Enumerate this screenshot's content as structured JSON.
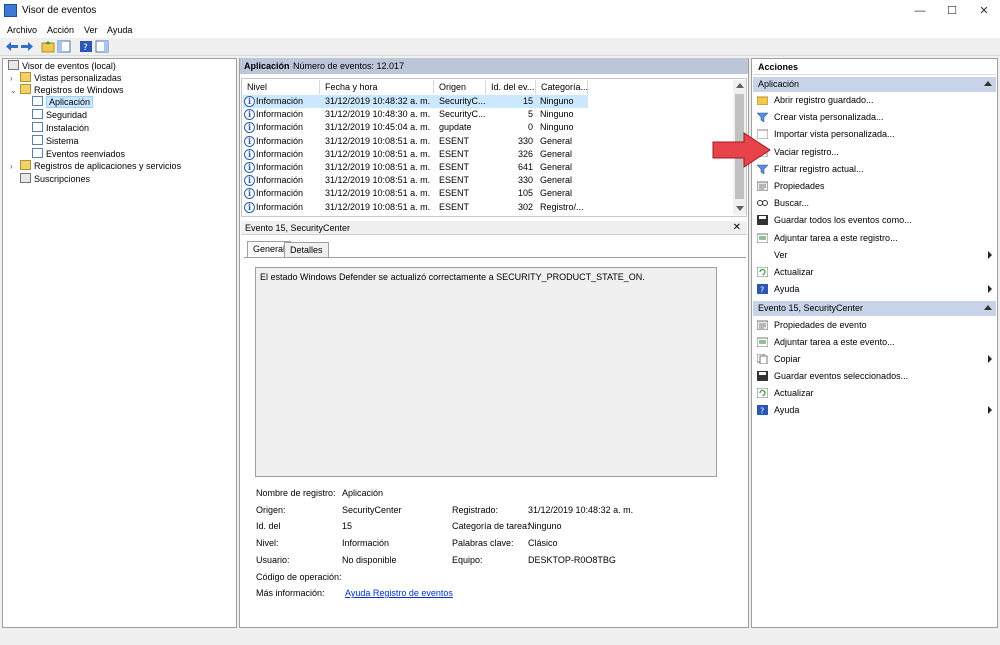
{
  "window": {
    "title": "Visor de eventos",
    "minimize": "—",
    "maximize": "☐",
    "close": "✕"
  },
  "menu": [
    "Archivo",
    "Acción",
    "Ver",
    "Ayuda"
  ],
  "tree": [
    {
      "label": "Visor de eventos (local)",
      "icon": "computer-icon"
    },
    {
      "label": "Vistas personalizadas",
      "icon": "folder-icon",
      "expander": "›"
    },
    {
      "label": "Registros de Windows",
      "icon": "folder-icon",
      "expander": "⌄"
    },
    {
      "label": "Aplicación",
      "icon": "log-icon"
    },
    {
      "label": "Seguridad",
      "icon": "log-icon"
    },
    {
      "label": "Instalación",
      "icon": "log-icon"
    },
    {
      "label": "Sistema",
      "icon": "log-icon"
    },
    {
      "label": "Eventos reenviados",
      "icon": "log-icon"
    },
    {
      "label": "Registros de aplicaciones y servicios",
      "icon": "folder-icon",
      "expander": "›"
    },
    {
      "label": "Suscripciones",
      "icon": "subscription-icon"
    }
  ],
  "center": {
    "log_name": "Aplicación",
    "event_count": "Número de eventos: 12.017",
    "columns": [
      "Nivel",
      "Fecha y hora",
      "Origen",
      "Id. del ev...",
      "Categoría..."
    ],
    "rows": [
      [
        "Información",
        "31/12/2019 10:48:32 a. m.",
        "SecurityC...",
        "15",
        "Ninguno"
      ],
      [
        "Información",
        "31/12/2019 10:48:30 a. m.",
        "SecurityC...",
        "5",
        "Ninguno"
      ],
      [
        "Información",
        "31/12/2019 10:45:04 a. m.",
        "gupdate",
        "0",
        "Ninguno"
      ],
      [
        "Información",
        "31/12/2019 10:08:51 a. m.",
        "ESENT",
        "330",
        "General"
      ],
      [
        "Información",
        "31/12/2019 10:08:51 a. m.",
        "ESENT",
        "326",
        "General"
      ],
      [
        "Información",
        "31/12/2019 10:08:51 a. m.",
        "ESENT",
        "641",
        "General"
      ],
      [
        "Información",
        "31/12/2019 10:08:51 a. m.",
        "ESENT",
        "330",
        "General"
      ],
      [
        "Información",
        "31/12/2019 10:08:51 a. m.",
        "ESENT",
        "105",
        "General"
      ],
      [
        "Información",
        "31/12/2019 10:08:51 a. m.",
        "ESENT",
        "302",
        "Registro/..."
      ]
    ]
  },
  "detail": {
    "title": "Evento 15, SecurityCenter",
    "close": "✕",
    "tabs": [
      "General",
      "Detalles"
    ],
    "message": "El estado Windows Defender se actualizó correctamente a SECURITY_PRODUCT_STATE_ON.",
    "left_labels": [
      "Nombre de registro:",
      "Origen:",
      "Id. del",
      "Nivel:",
      "Usuario:",
      "Código de operación:",
      "Más información:"
    ],
    "left_values": [
      "Aplicación",
      "SecurityCenter",
      "15",
      "Información",
      "No disponible",
      "",
      ""
    ],
    "more_info_link": "Ayuda Registro de eventos",
    "right_labels": [
      "Registrado:",
      "Categoría de tarea:",
      "Palabras clave:",
      "Equipo:"
    ],
    "right_values": [
      "31/12/2019 10:48:32 a. m.",
      "Ninguno",
      "Clásico",
      "DESKTOP-R0O8TBG"
    ]
  },
  "actions": {
    "title": "Acciones",
    "section1": "Aplicación",
    "items1": [
      {
        "label": "Abrir registro guardado...",
        "icon": "open-folder-icon"
      },
      {
        "label": "Crear vista personalizada...",
        "icon": "filter-icon"
      },
      {
        "label": "Importar vista personalizada...",
        "icon": "import-icon"
      },
      {
        "label": "Vaciar registro...",
        "icon": "clear-log-icon"
      },
      {
        "label": "Filtrar registro actual...",
        "icon": "filter-icon"
      },
      {
        "label": "Propiedades",
        "icon": "properties-icon"
      },
      {
        "label": "Buscar...",
        "icon": "find-icon"
      },
      {
        "label": "Guardar todos los eventos como...",
        "icon": "save-icon"
      },
      {
        "label": "Adjuntar tarea a este registro...",
        "icon": "task-icon"
      },
      {
        "label": "Ver",
        "icon": "",
        "submenu": true
      },
      {
        "label": "Actualizar",
        "icon": "refresh-icon"
      },
      {
        "label": "Ayuda",
        "icon": "help-icon",
        "submenu": true
      }
    ],
    "section2": "Evento 15, SecurityCenter",
    "items2": [
      {
        "label": "Propiedades de evento",
        "icon": "properties-icon"
      },
      {
        "label": "Adjuntar tarea a este evento...",
        "icon": "task-icon"
      },
      {
        "label": "Copiar",
        "icon": "copy-icon",
        "submenu": true
      },
      {
        "label": "Guardar eventos seleccionados...",
        "icon": "save-icon"
      },
      {
        "label": "Actualizar",
        "icon": "refresh-icon"
      },
      {
        "label": "Ayuda",
        "icon": "help-icon",
        "submenu": true
      }
    ]
  },
  "colors": {
    "accent_arrow": "#e8434a",
    "selection": "#cce8ff",
    "section_header": "#c6d3e8"
  }
}
